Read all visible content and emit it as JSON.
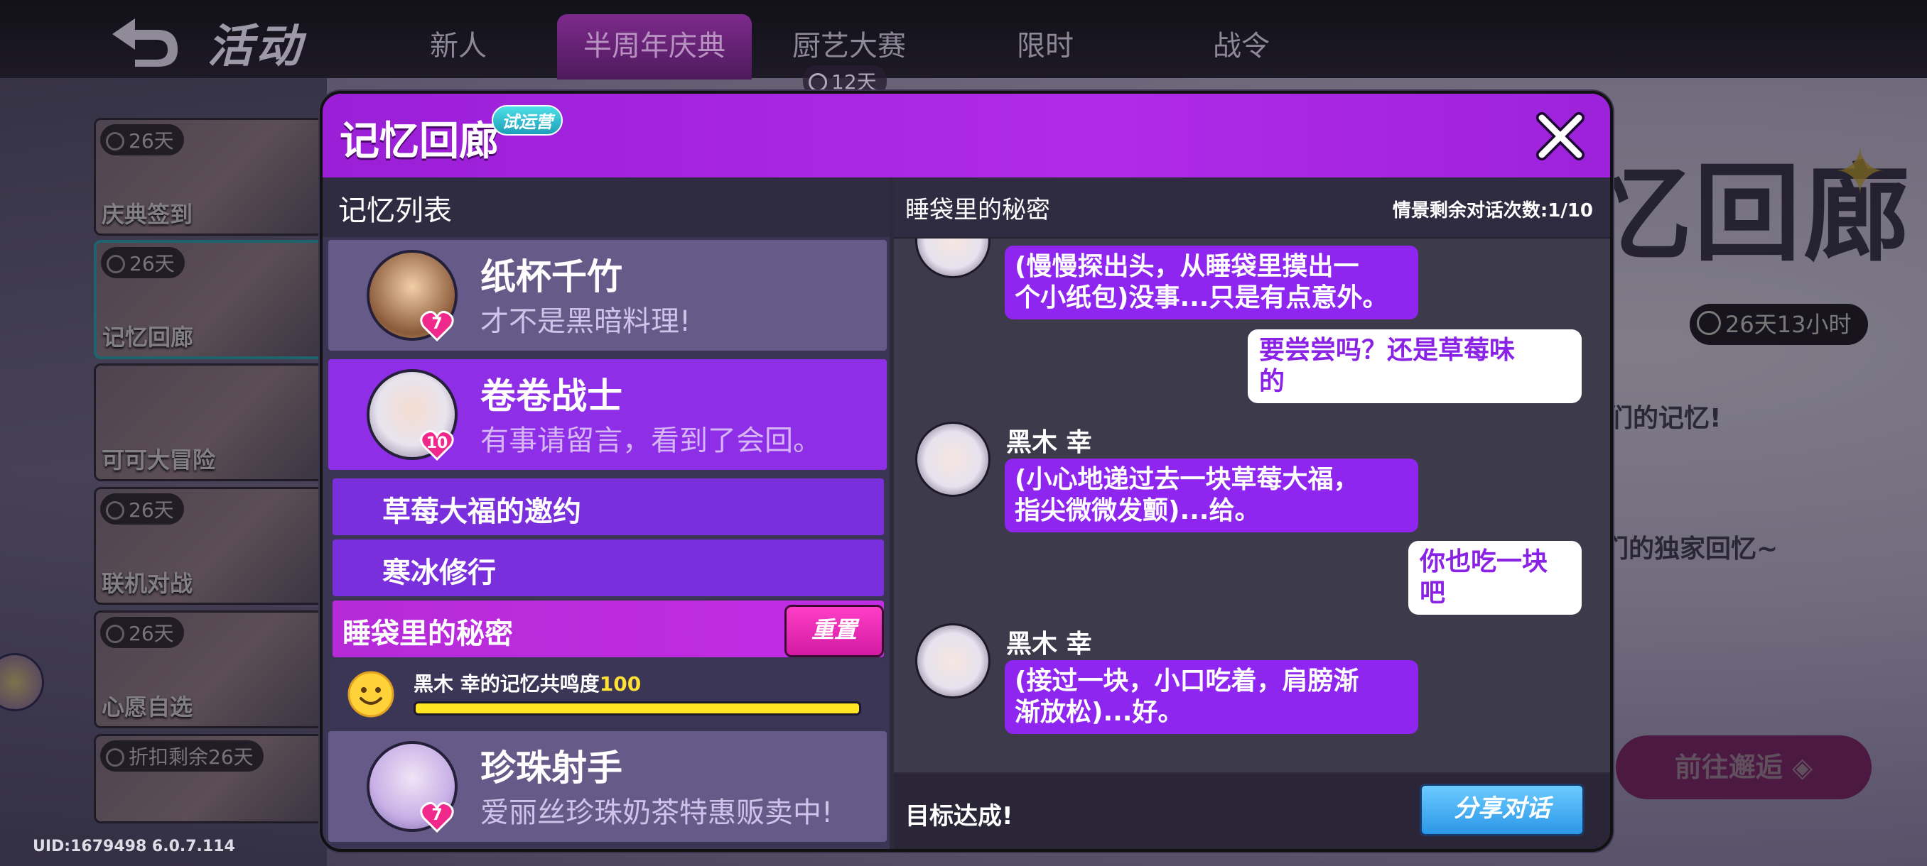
{
  "header": {
    "page_title": "活动",
    "tabs": [
      {
        "label": "新人"
      },
      {
        "label": "半周年庆典"
      },
      {
        "label": "厨艺大赛"
      },
      {
        "label": "限时"
      },
      {
        "label": "战令"
      }
    ],
    "active_tab": "半周年庆典",
    "tab_timer": "12天"
  },
  "events": [
    {
      "days": "26天",
      "label": "庆典签到"
    },
    {
      "days": "26天",
      "label": "记忆回廊"
    },
    {
      "days": "",
      "label": "可可大冒险"
    },
    {
      "days": "26天",
      "label": "联机对战"
    },
    {
      "days": "26天",
      "label": "心愿自选"
    },
    {
      "days": "折扣剩余26天",
      "label": ""
    }
  ],
  "uid": "UID:1679498 6.0.7.114",
  "background": {
    "title": "忆回廊",
    "timer": "26天13小时",
    "line1": "们的记忆!",
    "line2": "们的独家回忆~",
    "goto_button": "前往邂逅"
  },
  "modal": {
    "title": "记忆回廊",
    "badge": "试运营",
    "list_header": "记忆列表",
    "characters": [
      {
        "name": "纸杯千竹",
        "subtitle": "才不是黑暗料理!",
        "level": "7"
      },
      {
        "name": "卷卷战士",
        "subtitle": "有事请留言，看到了会回。",
        "level": "10"
      }
    ],
    "memories": [
      {
        "label": "草莓大福的邀约"
      },
      {
        "label": "寒冰修行"
      },
      {
        "label": "睡袋里的秘密"
      }
    ],
    "reset_button": "重置",
    "resonance": {
      "text": "黑木 幸的记忆共鸣度",
      "value": "100",
      "progress": 1.0
    },
    "next_character": {
      "name": "珍珠射手",
      "subtitle": "爱丽丝珍珠奶茶特惠贩卖中!",
      "level": "7"
    },
    "chat_title": "睡袋里的秘密",
    "remaining_label": "情景剩余对话次数:1/10",
    "messages": [
      {
        "speaker": "",
        "text_lines": [
          "(慢慢探出头，从睡袋里摸出一",
          "个小纸包)没事...只是有点意外。"
        ]
      },
      {
        "speaker": "me",
        "text_lines": [
          "要尝尝吗？还是草莓味",
          "的"
        ]
      },
      {
        "speaker": "黑木 幸",
        "text_lines": [
          "(小心地递过去一块草莓大福，",
          "指尖微微发颤)...给。"
        ]
      },
      {
        "speaker": "me",
        "text_lines": [
          "你也吃一块吧"
        ]
      },
      {
        "speaker": "黑木 幸",
        "text_lines": [
          "(接过一块，小口吃着，肩膀渐",
          "渐放松)...好。"
        ]
      }
    ],
    "goal_text": "目标达成!",
    "share_button": "分享对话"
  },
  "colors": {
    "header_purple": "#b12ae8",
    "active_row": "#8e2ee6",
    "bubble_npc": "#8f26ef",
    "resonance_bar": "#ffe522",
    "share_button": "#2b97e8",
    "reset_button": "#e424b4"
  },
  "icons": [
    "back-icon",
    "clock-icon",
    "close-icon",
    "heart-icon",
    "smile-icon"
  ]
}
